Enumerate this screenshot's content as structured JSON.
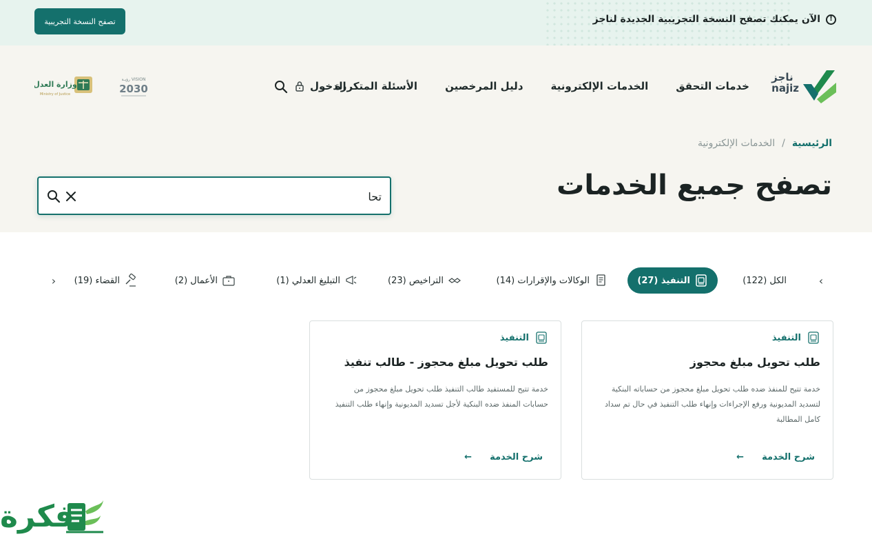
{
  "banner": {
    "message": "الآن يمكنك تصفح النسخة التجريبية الجديدة لناجز",
    "button_label": "تصفح النسخة التجريبية"
  },
  "header": {
    "logo_ar": "ناجز",
    "logo_en": "najiz",
    "nav": [
      "خدمات التحقق",
      "الخدمات الإلكترونية",
      "دليل المرخصين",
      "الأسئلة المتكررة"
    ],
    "login_label": "الدخول",
    "vision_label": "VISION 2030",
    "ministry_label": "Ministry of Justice"
  },
  "breadcrumb": {
    "home": "الرئيسية",
    "separator": "/",
    "current": "الخدمات الإلكترونية"
  },
  "page_title": "تصفح جميع الخدمات",
  "search": {
    "value": "تحا",
    "placeholder": ""
  },
  "tabs": [
    {
      "label": "الكل (122)",
      "icon": "none",
      "active": false
    },
    {
      "label": "التنفيذ (27)",
      "icon": "document-icon",
      "active": true
    },
    {
      "label": "الوكالات والإقرارات (14)",
      "icon": "papers-icon",
      "active": false
    },
    {
      "label": "التراخيص (23)",
      "icon": "handshake-icon",
      "active": false
    },
    {
      "label": "التبليغ العدلي (1)",
      "icon": "megaphone-icon",
      "active": false
    },
    {
      "label": "الأعمال (2)",
      "icon": "briefcase-icon",
      "active": false
    },
    {
      "label": "القضاء (19)",
      "icon": "gavel-icon",
      "active": false
    }
  ],
  "cards": [
    {
      "category": "التنفيذ",
      "title": "طلب تحويل مبلغ محجوز",
      "description_lines": [
        "خدمة تتيح للمنفذ ضده طلب تحويل مبلغ محجوز من حساباته البنكية",
        "لتسديد المديونية ورفع الإجراءات وإنهاء طلب التنفيذ في حال تم سداد",
        "كامل المطالبة"
      ],
      "link_label": "شرح الخدمة"
    },
    {
      "category": "التنفيذ",
      "title": "طلب تحويل مبلغ محجوز - طالب تنفيذ",
      "description_lines": [
        "خدمة تتيح للمستفيد طالب التنفيذ طلب تحويل مبلغ محجوز من",
        "حسابات المنفذ ضده البنكية لأجل تسديد المديونية وإنهاء طلب التنفيذ"
      ],
      "link_label": "شرح الخدمة"
    }
  ],
  "watermark": "فكرة",
  "colors": {
    "primary": "#14706c",
    "banner_bg": "#e7f3ee",
    "hero_bg": "#f6f5f0",
    "logo_green": "#1f8a4c"
  }
}
